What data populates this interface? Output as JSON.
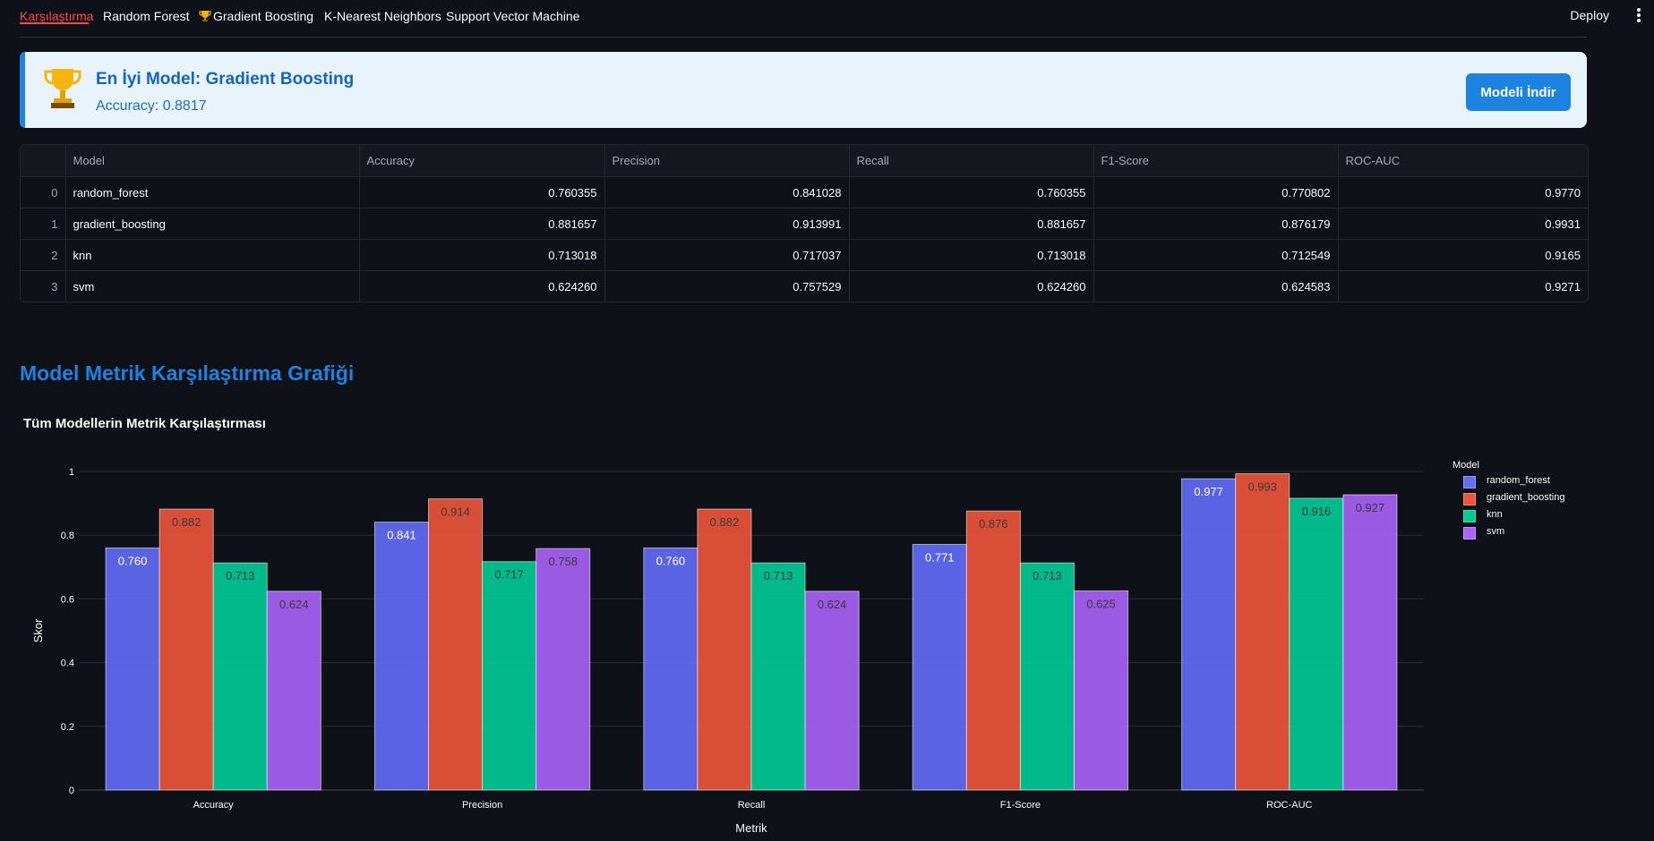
{
  "tabs": [
    {
      "label": "Karşılaştırma",
      "active": true
    },
    {
      "label": "Random Forest",
      "active": false
    },
    {
      "label": "Gradient Boosting",
      "active": false,
      "icon": "trophy-icon"
    },
    {
      "label": "K-Nearest Neighbors",
      "active": false
    },
    {
      "label": "Support Vector Machine",
      "active": false
    }
  ],
  "header": {
    "deploy_label": "Deploy",
    "menu_icon": "kebab-menu-icon"
  },
  "banner": {
    "icon": "trophy-icon",
    "title": "En İyi Model: Gradient Boosting",
    "subtitle": "Accuracy: 0.8817",
    "button_label": "Modeli İndir",
    "accent": "#1c83e1"
  },
  "table": {
    "columns": [
      "",
      "Model",
      "Accuracy",
      "Precision",
      "Recall",
      "F1-Score",
      "ROC-AUC"
    ],
    "rows": [
      [
        "0",
        "random_forest",
        "0.760355",
        "0.841028",
        "0.760355",
        "0.770802",
        "0.9770"
      ],
      [
        "1",
        "gradient_boosting",
        "0.881657",
        "0.913991",
        "0.881657",
        "0.876179",
        "0.9931"
      ],
      [
        "2",
        "knn",
        "0.713018",
        "0.717037",
        "0.713018",
        "0.712549",
        "0.9165"
      ],
      [
        "3",
        "svm",
        "0.624260",
        "0.757529",
        "0.624260",
        "0.624583",
        "0.9271"
      ]
    ]
  },
  "section_title": "Model Metrik Karşılaştırma Grafiği",
  "chart_data": {
    "type": "bar",
    "title": "Tüm Modellerin Metrik Karşılaştırması",
    "xlabel": "Metrik",
    "ylabel": "Skor",
    "categories": [
      "Accuracy",
      "Precision",
      "Recall",
      "F1-Score",
      "ROC-AUC"
    ],
    "ylim": [
      0,
      1
    ],
    "yticks": [
      "0",
      "0.2",
      "0.4",
      "0.6",
      "0.8",
      "1"
    ],
    "grid": true,
    "legend_title": "Model",
    "legend_position": "right",
    "series": [
      {
        "name": "random_forest",
        "color": "#636efa",
        "values": [
          0.76,
          0.841,
          0.76,
          0.771,
          0.977
        ]
      },
      {
        "name": "gradient_boosting",
        "color": "#ef553b",
        "values": [
          0.882,
          0.914,
          0.882,
          0.876,
          0.993
        ]
      },
      {
        "name": "knn",
        "color": "#00cc96",
        "values": [
          0.713,
          0.717,
          0.713,
          0.713,
          0.916
        ]
      },
      {
        "name": "svm",
        "color": "#ab63fa",
        "values": [
          0.624,
          0.758,
          0.624,
          0.625,
          0.927
        ]
      }
    ]
  }
}
